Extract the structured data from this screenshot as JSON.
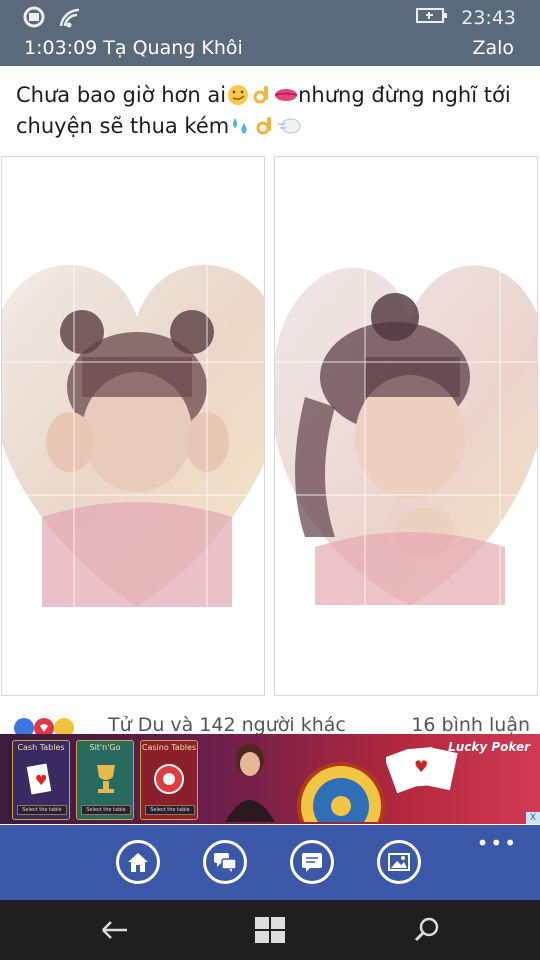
{
  "status": {
    "time": "23:43",
    "icons": [
      "signal-icon",
      "wifi-icon",
      "battery-charging-icon"
    ]
  },
  "title": {
    "chat_title": "1:03:09 Tạ Quang Khôi",
    "app_name": "Zalo"
  },
  "post": {
    "text_part1": "Chưa bao giờ hơn ai",
    "text_part2": "nhưng đừng nghĩ tới chuyện sẽ thua kém"
  },
  "reactions": {
    "likes_text": "Tử Du và 142 người khác",
    "comments_text": "16 bình luận"
  },
  "ad": {
    "brand": "Lucky Poker",
    "cards": [
      "Cash Tables",
      "Sit'n'Go",
      "Casino Tables"
    ],
    "select_label": "Select the table",
    "close_label": "X"
  },
  "appbar": {
    "buttons": [
      "home-icon",
      "chat-icon",
      "message-icon",
      "image-icon"
    ],
    "more_label": "•••"
  },
  "navbar": {
    "buttons": [
      "back-icon",
      "windows-icon",
      "search-icon"
    ]
  },
  "colors": {
    "statusbar": "#5a6a7a",
    "appbar": "#3b58a8",
    "navbar": "#1f1f1f"
  }
}
